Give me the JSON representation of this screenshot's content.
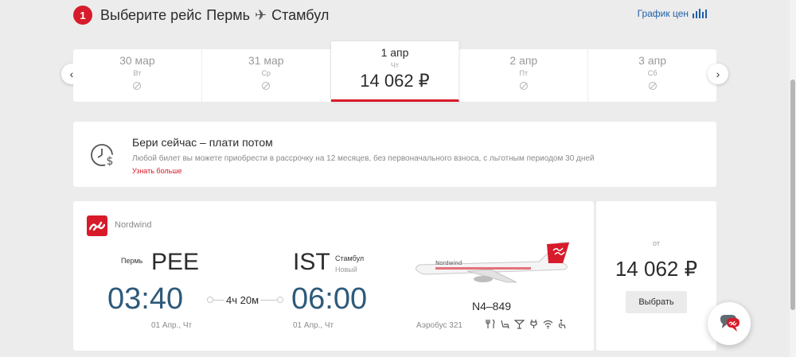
{
  "step": {
    "number": "1",
    "title_prefix": "Выберите рейс",
    "origin": "Пермь",
    "destination": "Стамбул",
    "price_chart_label": "График цен"
  },
  "dates": [
    {
      "date": "30 мар",
      "day": "Вт",
      "price": null,
      "available": false
    },
    {
      "date": "31 мар",
      "day": "Ср",
      "price": null,
      "available": false
    },
    {
      "date": "1 апр",
      "day": "Чт",
      "price": "14 062 ₽",
      "available": true,
      "selected": true
    },
    {
      "date": "2 апр",
      "day": "Пт",
      "price": null,
      "available": false
    },
    {
      "date": "3 апр",
      "day": "Сб",
      "price": null,
      "available": false
    }
  ],
  "promo": {
    "title": "Бери сейчас – плати потом",
    "text": "Любой билет вы можете приобрести в рассрочку на 12 месяцев, без первоначального взноса, с льготным периодом 30 дней",
    "link": "Узнать больше"
  },
  "flight": {
    "airline": "Nordwind",
    "from_city": "Пермь",
    "from_code": "PEE",
    "dep_time": "03:40",
    "dep_date": "01 Апр., Чт",
    "duration": "4ч 20м",
    "to_code": "IST",
    "to_city": "Стамбул",
    "to_airport": "Новый",
    "arr_time": "06:00",
    "arr_date": "01 Апр., Чт",
    "flight_number": "N4–849",
    "aircraft": "Аэробус 321",
    "amenities": [
      "meal-icon",
      "seat-recline-icon",
      "drinks-icon",
      "power-outlet-icon",
      "wifi-icon",
      "accessibility-icon"
    ]
  },
  "price": {
    "from_label": "от",
    "value": "14 062 ₽",
    "select_label": "Выбрать"
  },
  "colors": {
    "brand_red": "#d71b2a",
    "time_blue": "#2e5a7a",
    "link_blue": "#1d5fa8"
  }
}
